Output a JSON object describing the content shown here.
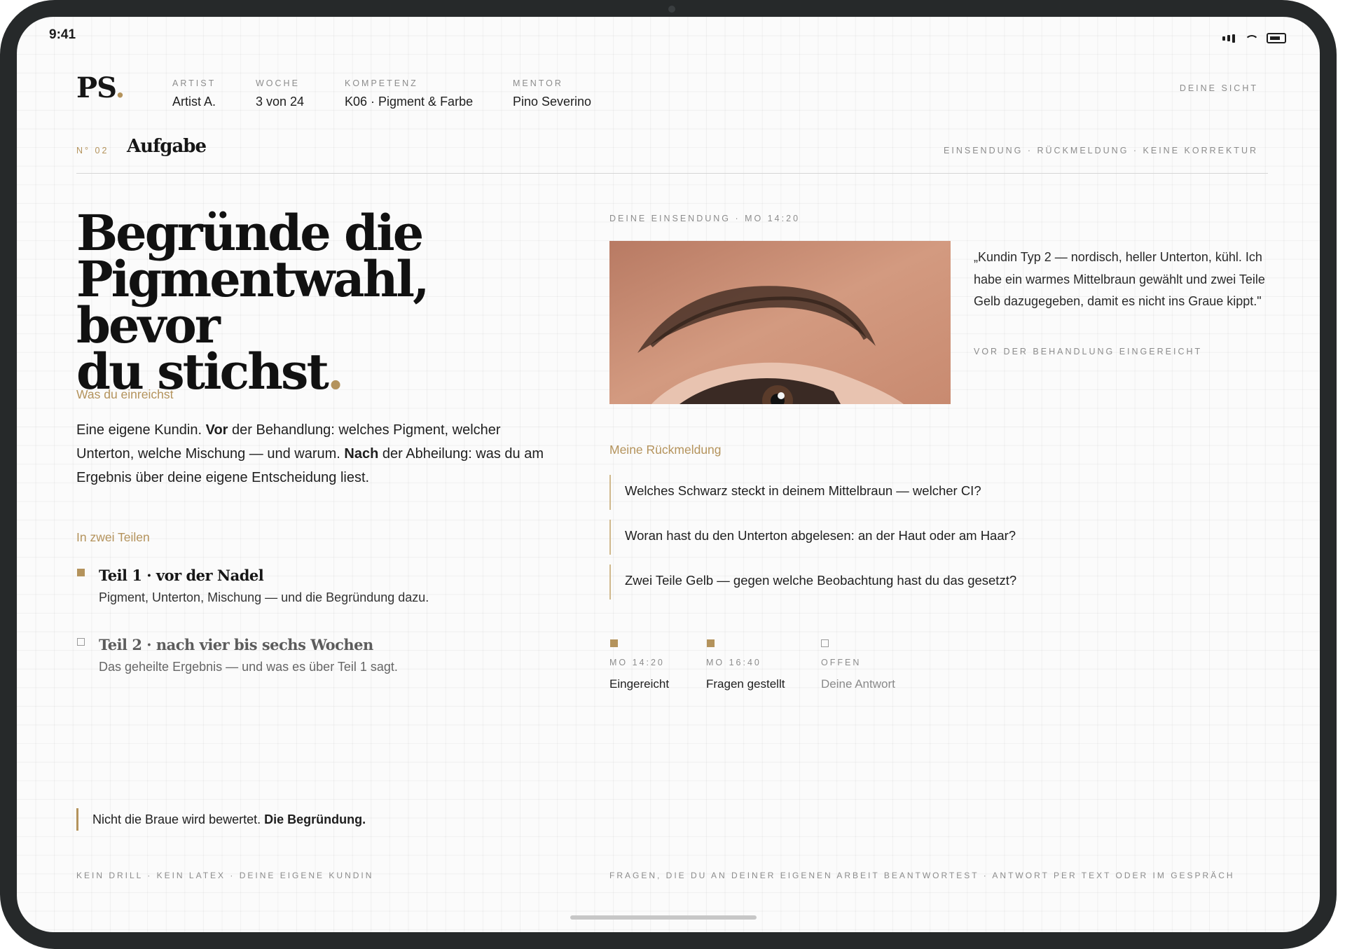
{
  "status_bar": {
    "time": "9:41"
  },
  "header": {
    "logo": "PS",
    "logo_dot": ".",
    "meta": [
      {
        "key": "ARTIST",
        "value": "Artist A."
      },
      {
        "key": "WOCHE",
        "value": "3 von 24"
      },
      {
        "key": "KOMPETENZ",
        "value": "K06 · Pigment & Farbe"
      },
      {
        "key": "MENTOR",
        "value": "Pino Severino"
      }
    ],
    "view_label": "DEINE SICHT"
  },
  "section_bar": {
    "number": "N° 02",
    "title": "Aufgabe",
    "steps": "EINSENDUNG · RÜCKMELDUNG · KEINE KORREKTUR"
  },
  "task": {
    "headline_1": "Begründe die",
    "headline_2": "Pigmentwahl, bevor",
    "headline_3": "du stichst",
    "headline_dot": ".",
    "submit_label": "Was du einreichst",
    "submit_text_1": "Eine eigene Kundin. ",
    "submit_text_2": "Vor",
    "submit_text_3": " der Behandlung: welches Pigment, welcher Unterton, welche Mischung — und warum. ",
    "submit_text_4": "Nach",
    "submit_text_5": " der Abheilung: was du am Ergebnis über deine eigene Entscheidung liest.",
    "parts_label": "In zwei Teilen",
    "parts": [
      {
        "title": "Teil 1 · vor der Nadel",
        "desc": "Pigment, Unterton, Mischung — und die Begründung dazu.",
        "done": true
      },
      {
        "title": "Teil 2 · nach vier bis sechs Wochen",
        "desc": "Das geheilte Ergebnis — und was es über Teil 1 sagt.",
        "done": false
      }
    ]
  },
  "submission": {
    "label": "DEINE EINSENDUNG · MO 14:20",
    "quote": "„Kundin Typ 2 — nordisch, heller Unterton, kühl. Ich habe ein warmes Mittelbraun gewählt und zwei Teile Gelb dazugegeben, damit es nicht ins Graue kippt.\"",
    "quote_note": "VOR DER BEHANDLUNG EINGEREICHT"
  },
  "feedback": {
    "label": "Meine Rückmeldung",
    "questions": [
      "Welches Schwarz steckt in deinem Mittelbraun — welcher CI?",
      "Woran hast du den Unterton abgelesen: an der Haut oder am Haar?",
      "Zwei Teile Gelb — gegen welche Beobachtung hast du das gesetzt?"
    ]
  },
  "timeline": [
    {
      "time": "MO 14:20",
      "label": "Eingereicht",
      "done": true
    },
    {
      "time": "MO 16:40",
      "label": "Fragen gestellt",
      "done": true
    },
    {
      "time": "OFFEN",
      "label": "Deine Antwort",
      "done": false
    }
  ],
  "footer": {
    "note_1": "Nicht die Braue wird bewertet. ",
    "note_2": "Die Begründung.",
    "left": "KEIN DRILL · KEIN LATEX · DEINE EIGENE KUNDIN",
    "right": "FRAGEN, DIE DU AN DEINER EIGENEN ARBEIT BEANTWORTEST · ANTWORT PER TEXT ODER IM GESPRÄCH"
  },
  "colors": {
    "accent": "#b4935c",
    "frame": "#26292a"
  }
}
